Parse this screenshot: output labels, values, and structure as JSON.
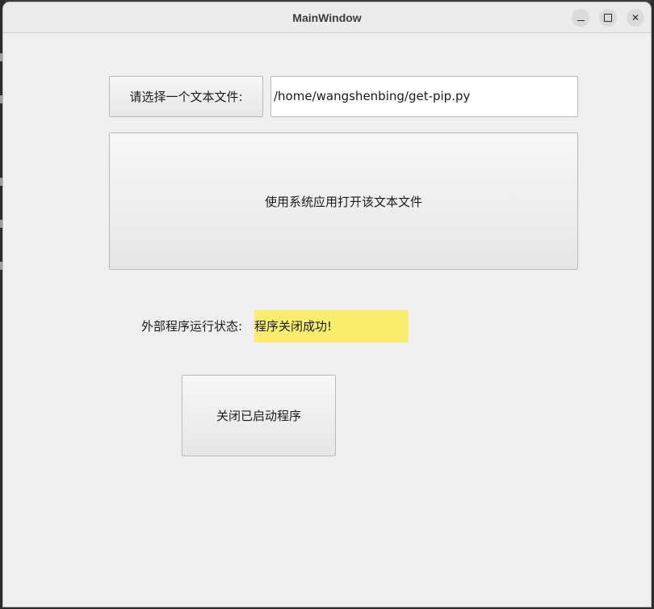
{
  "window": {
    "title": "MainWindow",
    "controls": [
      "minimize-icon",
      "maximize-icon",
      "close-icon"
    ]
  },
  "file_row": {
    "choose_label": "请选择一个文本文件:",
    "path_value": "/home/wangshenbing/get-pip.py"
  },
  "open_button": {
    "label": "使用系统应用打开该文本文件"
  },
  "status": {
    "label": "外部程序运行状态:",
    "value": "程序关闭成功!",
    "highlight_color": "#f9ee6b"
  },
  "close_button": {
    "label": "关闭已启动程序"
  }
}
